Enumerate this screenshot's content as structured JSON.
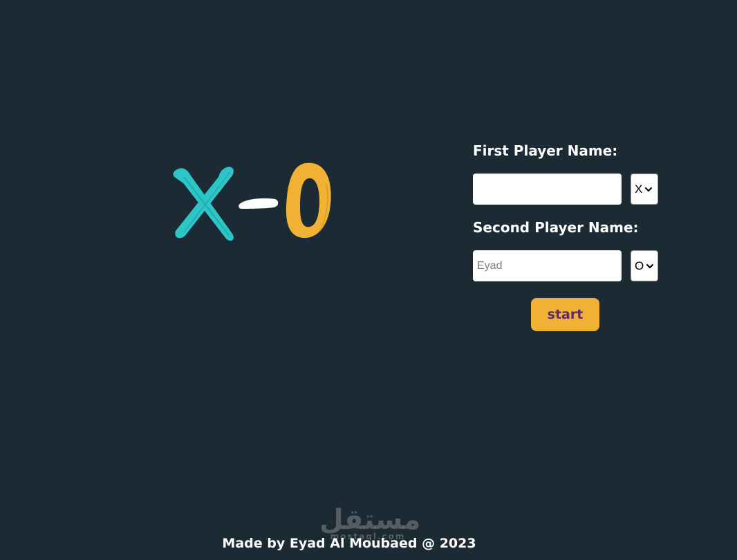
{
  "logo": {
    "x_mark": "X",
    "o_mark": "O",
    "x_color": "#2cc5c8",
    "dash_color": "#ffffff",
    "o_color": "#f0b135"
  },
  "form": {
    "first_label": "First Player Name:",
    "first_name_value": "",
    "first_name_placeholder": "",
    "first_symbol": "X",
    "second_label": "Second Player Name:",
    "second_name_value": "",
    "second_name_placeholder": "Eyad",
    "second_symbol": "O",
    "start_label": "start"
  },
  "footer": {
    "text": "Made by Eyad Al Moubaed @ 2023"
  },
  "watermark": {
    "text": "مستقل",
    "sub": "mostaql.com"
  },
  "colors": {
    "background": "#1c2a33",
    "accent": "#f0b135",
    "teal": "#2cc5c8",
    "button_text": "#5a2a6e"
  }
}
